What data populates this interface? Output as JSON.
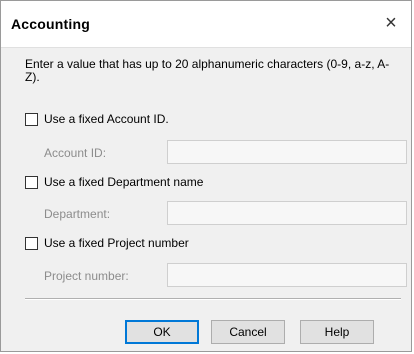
{
  "window": {
    "title": "Accounting",
    "close_icon": "×"
  },
  "intro_text": "Enter a value that has up to 20 alphanumeric characters (0-9, a-z, A-Z).",
  "account": {
    "checkbox_label": "Use a fixed Account ID.",
    "field_label": "Account ID:",
    "field_value": ""
  },
  "department": {
    "checkbox_label": "Use a fixed Department name",
    "field_label": "Department:",
    "field_value": ""
  },
  "project": {
    "checkbox_label": "Use a fixed Project number",
    "field_label": "Project number:",
    "field_value": ""
  },
  "buttons": {
    "ok": "OK",
    "cancel": "Cancel",
    "help": "Help"
  },
  "colors": {
    "default_button_border": "#0078d7",
    "disabled_text": "#8c8c8c"
  }
}
